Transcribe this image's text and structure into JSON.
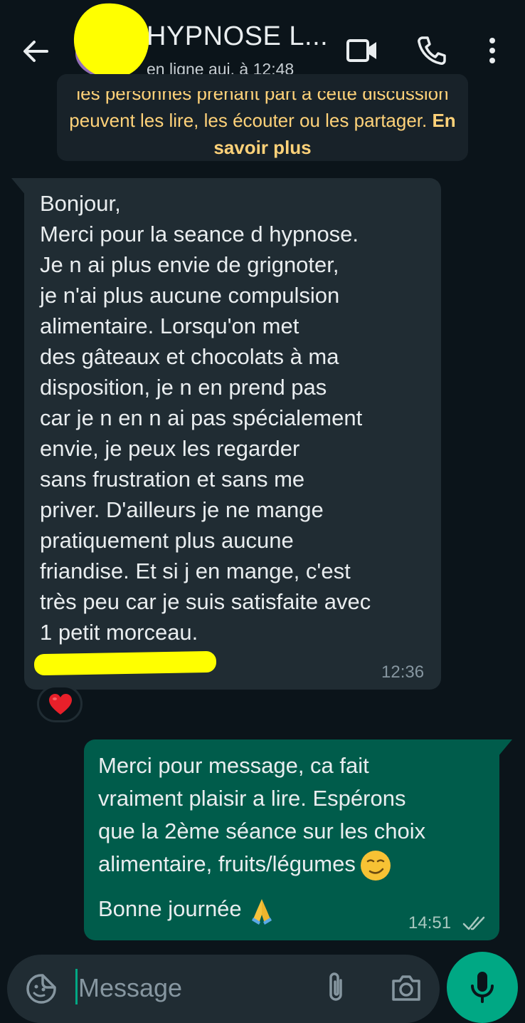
{
  "header": {
    "contact_name": "HYPNOSE L...",
    "status": "en ligne auj. à 12:48",
    "back_icon": "arrow-left-icon",
    "video_icon": "video-call-icon",
    "call_icon": "phone-icon",
    "menu_icon": "more-vertical-icon"
  },
  "encryption_notice": {
    "text": "les personnes prenant part à cette discussion peuvent les lire, les écouter ou les partager. ",
    "link": "En savoir plus"
  },
  "incoming_message": {
    "text": "Bonjour,\nMerci pour la seance d hypnose.\nJe n ai plus envie de grignoter,\nje n'ai plus aucune compulsion\nalimentaire. Lorsqu'on met\ndes gâteaux et chocolats à ma\ndisposition, je n en prend pas\ncar je n en n ai pas spécialement\nenvie, je peux les regarder\nsans frustration et sans me\npriver. D'ailleurs je ne mange\npratiquement plus aucune\nfriandise. Et si j en mange, c'est\ntrès peu car je suis satisfaite avec\n1 petit morceau.",
    "time": "12:36",
    "reaction": "❤"
  },
  "outgoing_message": {
    "lines": [
      "Merci pour message, ca fait",
      "vraiment plaisir a lire. Espérons",
      "que la 2ème séance sur les choix",
      "alimentaire, fruits/légumes"
    ],
    "closing": "Bonne journée",
    "emoji_1": "smirking-face-emoji",
    "emoji_2": "folded-hands-emoji",
    "time": "14:51",
    "status_icon": "double-check-icon"
  },
  "composer": {
    "placeholder": "Message",
    "sticker_icon": "sticker-icon",
    "attach_icon": "paperclip-icon",
    "camera_icon": "camera-icon",
    "mic_icon": "microphone-icon"
  },
  "colors": {
    "background": "#0b141a",
    "incoming_bubble": "#202c33",
    "outgoing_bubble": "#005c4b",
    "accent": "#00a884",
    "notice_text": "#ffd279"
  }
}
